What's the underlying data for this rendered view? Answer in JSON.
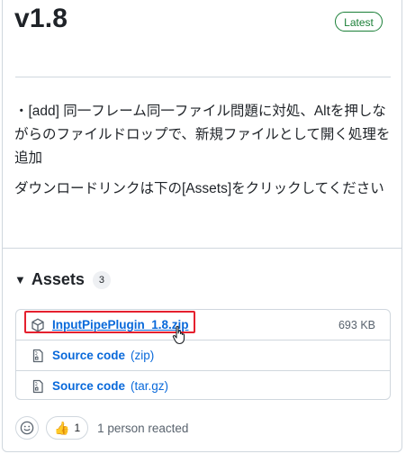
{
  "release": {
    "title": "v1.8",
    "badge": "Latest",
    "notes": [
      "・[add] 同一フレーム同一ファイル問題に対処、Altを押しながらのファイルドロップで、新規ファイルとして開く処理を追加",
      "ダウンロードリンクは下の[Assets]をクリックしてください"
    ]
  },
  "assets": {
    "title": "Assets",
    "count": "3",
    "items": [
      {
        "name": "InputPipePlugin_1.8.zip",
        "sub": "",
        "size": "693 KB",
        "icon": "package-icon"
      },
      {
        "name": "Source code",
        "sub": "(zip)",
        "size": "",
        "icon": "file-zip-icon"
      },
      {
        "name": "Source code",
        "sub": "(tar.gz)",
        "size": "",
        "icon": "file-zip-icon"
      }
    ]
  },
  "reactions": {
    "thumbs_emoji": "👍",
    "thumbs_count": "1",
    "summary": "1 person reacted"
  },
  "colors": {
    "link": "#0969da",
    "latest_badge": "#1a7f37",
    "highlight_box": "#e5202e"
  }
}
